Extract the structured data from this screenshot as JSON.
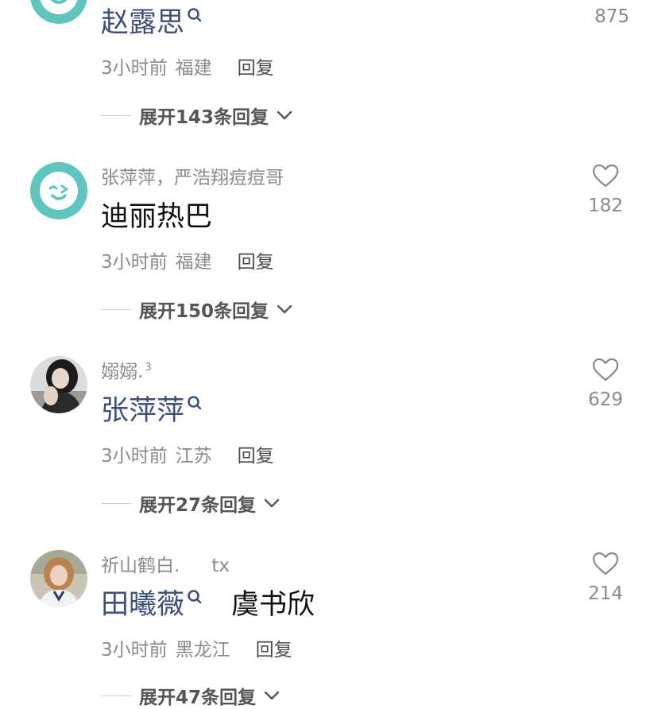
{
  "comments": [
    {
      "username": "",
      "mention": "赵露思",
      "after_text": "",
      "time": "3小时前",
      "location": "福建",
      "reply_label": "回复",
      "expand_label": "展开143条回复",
      "likes": "875",
      "avatar": "smile-emoji-avatar"
    },
    {
      "username": "张萍萍，严浩翔痘痘哥",
      "text": "迪丽热巴",
      "time": "3小时前",
      "location": "福建",
      "reply_label": "回复",
      "expand_label": "展开150条回复",
      "likes": "182",
      "avatar": "wink-emoji-avatar"
    },
    {
      "username": "嫋嫋.",
      "username_sup": "3",
      "mention": "张萍萍",
      "time": "3小时前",
      "location": "江苏",
      "reply_label": "回复",
      "expand_label": "展开27条回复",
      "likes": "629",
      "avatar": "photo-girl-avatar"
    },
    {
      "username": "祈山鹤白.",
      "username_extra": "tx",
      "mention": "田曦薇",
      "after_text": "虞书欣",
      "time": "3小时前",
      "location": "黑龙江",
      "reply_label": "回复",
      "expand_label": "展开47条回复",
      "likes": "214",
      "avatar": "photo-woman-avatar"
    }
  ],
  "colors": {
    "mention": "#3d4f7e",
    "muted": "#8a8a8a",
    "avatar_teal": "#5fc5bf"
  },
  "icons": {
    "like": "heart-outline-icon",
    "expand": "chevron-down-icon",
    "mention_search": "search-icon"
  }
}
